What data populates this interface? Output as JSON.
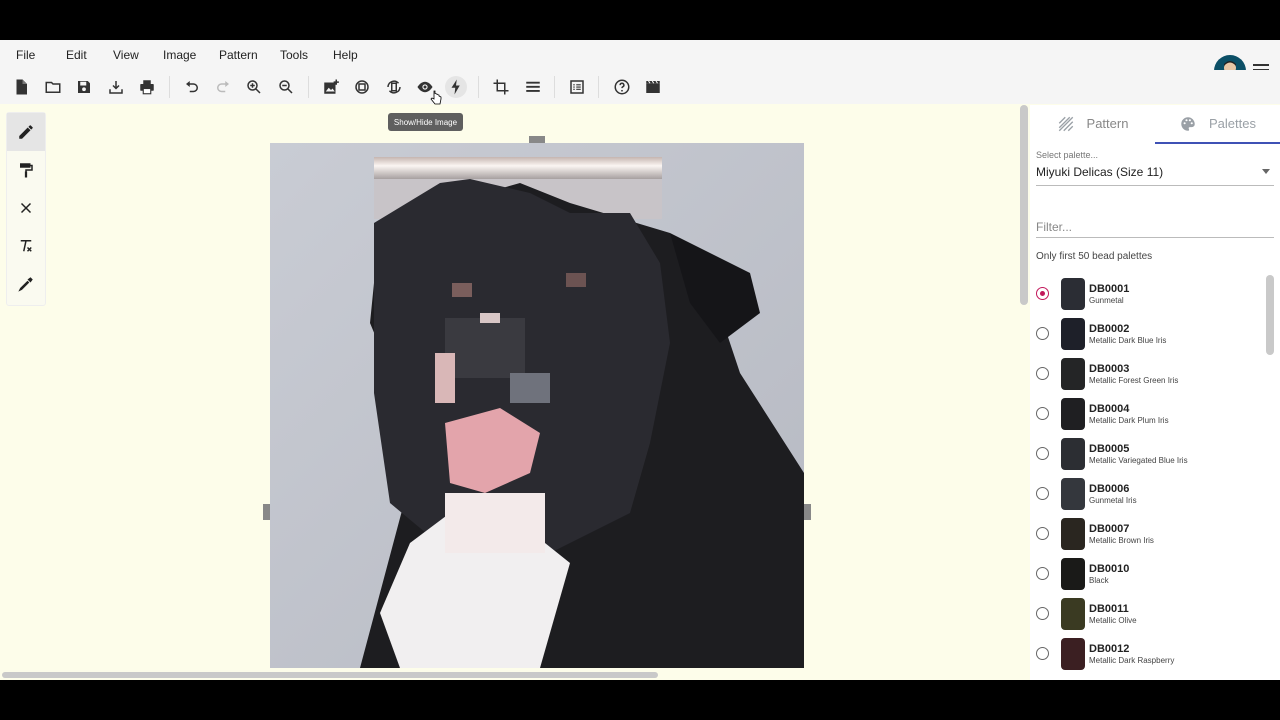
{
  "menu": [
    "File",
    "Edit",
    "View",
    "Image",
    "Pattern",
    "Tools",
    "Help"
  ],
  "toolbar": {
    "tooltip": "Show/Hide Image",
    "icons": [
      "new-file-icon",
      "open-folder-icon",
      "save-icon",
      "download-icon",
      "print-icon",
      "undo-icon",
      "redo-icon",
      "zoom-in-icon",
      "zoom-out-icon",
      "add-image-icon",
      "rotate-image-icon",
      "flip-image-icon",
      "eye-icon",
      "flash-icon",
      "crop-icon",
      "lines-icon",
      "list-icon",
      "help-icon",
      "movie-icon"
    ]
  },
  "left_tools": [
    "pencil-icon",
    "paint-roller-icon",
    "close-icon",
    "clear-format-icon",
    "eyedropper-icon"
  ],
  "panel": {
    "tabs": [
      {
        "label": "Pattern",
        "icon": "hatch-icon"
      },
      {
        "label": "Palettes",
        "icon": "palette-icon"
      }
    ],
    "select_label": "Select palette...",
    "select_value": "Miyuki Delicas (Size 11)",
    "filter_placeholder": "Filter...",
    "note": "Only first 50 bead palettes",
    "items": [
      {
        "code": "DB0001",
        "name": "Gunmetal",
        "color": "#2b2d34",
        "selected": true
      },
      {
        "code": "DB0002",
        "name": "Metallic Dark Blue Iris",
        "color": "#1e2029",
        "selected": false
      },
      {
        "code": "DB0003",
        "name": "Metallic Forest Green Iris",
        "color": "#242526",
        "selected": false
      },
      {
        "code": "DB0004",
        "name": "Metallic Dark Plum Iris",
        "color": "#1f1f22",
        "selected": false
      },
      {
        "code": "DB0005",
        "name": "Metallic Variegated Blue Iris",
        "color": "#2c2e33",
        "selected": false
      },
      {
        "code": "DB0006",
        "name": "Gunmetal Iris",
        "color": "#34373d",
        "selected": false
      },
      {
        "code": "DB0007",
        "name": "Metallic Brown Iris",
        "color": "#2a2620",
        "selected": false
      },
      {
        "code": "DB0010",
        "name": "Black",
        "color": "#1a1a18",
        "selected": false
      },
      {
        "code": "DB0011",
        "name": "Metallic Olive",
        "color": "#3a3a22",
        "selected": false
      },
      {
        "code": "DB0012",
        "name": "Metallic Dark Raspberry",
        "color": "#3b1f22",
        "selected": false
      }
    ]
  }
}
